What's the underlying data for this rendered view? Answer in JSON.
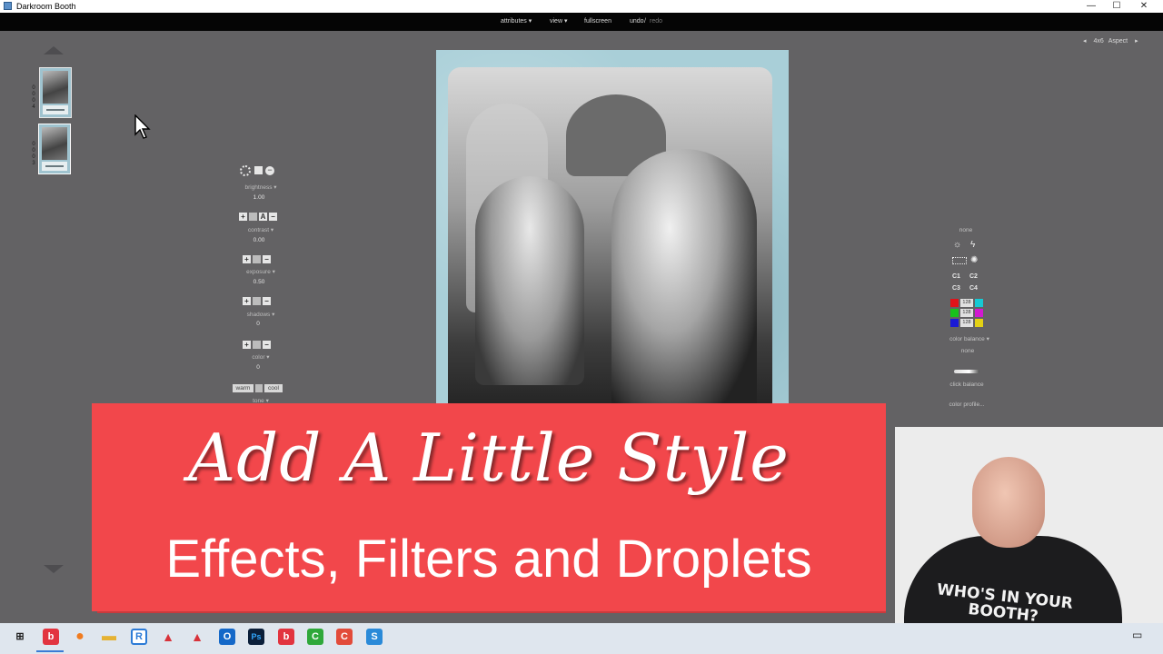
{
  "window": {
    "title": "Darkroom Booth",
    "controls": {
      "minimize": "—",
      "maximize": "☐",
      "close": "✕"
    }
  },
  "menu": {
    "attributes": "attributes ▾",
    "view": "view ▾",
    "fullscreen": "fullscreen",
    "undo": "undo",
    "sep": " / ",
    "redo": "redo"
  },
  "aspect": {
    "prev": "◂",
    "size": "4x6",
    "label": "Aspect",
    "next": "▸"
  },
  "thumbnails": [
    {
      "counter": [
        "0",
        "0",
        "0",
        "4"
      ]
    },
    {
      "counter": [
        "0",
        "0",
        "0",
        "3"
      ]
    }
  ],
  "adjustments": {
    "brightness": {
      "label": "brightness ▾",
      "value": "1.00"
    },
    "contrast": {
      "label": "contrast ▾",
      "value": "0.00",
      "auto": "A"
    },
    "exposure": {
      "label": "exposure ▾",
      "value": "0.50"
    },
    "shadows": {
      "label": "shadows ▾",
      "value": "0"
    },
    "color": {
      "label": "color ▾",
      "value": "0"
    },
    "tone": {
      "label": "tone ▾",
      "warm": "warm",
      "cool": "cool"
    }
  },
  "color_panel": {
    "preset": "none",
    "c_buttons": [
      "C1",
      "C2",
      "C3",
      "C4"
    ],
    "balance_values": [
      "128",
      "128",
      "128"
    ],
    "channel_colors": {
      "left": [
        "#e0121a",
        "#19c11c",
        "#1a1ad6"
      ],
      "right": [
        "#16c9d4",
        "#d11ad0",
        "#e3d114"
      ]
    },
    "balance_label": "color balance ▾",
    "balance_preset": "none",
    "click_balance": "click balance",
    "color_profile": "color profile..."
  },
  "banner": {
    "title": "Add A Little Style",
    "subtitle": "Effects, Filters and Droplets",
    "color": "#f2474b"
  },
  "presenter": {
    "shirt_text": "WHO'S IN YOUR BOOTH?"
  },
  "taskbar": {
    "icons": [
      {
        "name": "windows-start-icon",
        "glyph": "⊞",
        "color": "#1e1e1e"
      },
      {
        "name": "b-app-icon",
        "glyph": "b",
        "color": "#e2343f"
      },
      {
        "name": "firefox-icon",
        "glyph": "●",
        "color": "#f07b1f"
      },
      {
        "name": "file-explorer-icon",
        "glyph": "▬",
        "color": "#e5b233"
      },
      {
        "name": "r-app-icon",
        "glyph": "R",
        "color": "#2c7bd6"
      },
      {
        "name": "alert-app-icon-1",
        "glyph": "▲",
        "color": "#d8323a"
      },
      {
        "name": "alert-app-icon-2",
        "glyph": "▲",
        "color": "#d8323a"
      },
      {
        "name": "outlook-icon",
        "glyph": "O",
        "color": "#1468c8"
      },
      {
        "name": "photoshop-icon",
        "glyph": "Ps",
        "color": "#0b1f3a"
      },
      {
        "name": "b-app-icon-2",
        "glyph": "b",
        "color": "#e2343f"
      },
      {
        "name": "c-app-icon-green",
        "glyph": "C",
        "color": "#2fa83a"
      },
      {
        "name": "c-app-icon-red",
        "glyph": "C",
        "color": "#e24b3a"
      },
      {
        "name": "s-app-icon",
        "glyph": "S",
        "color": "#2a8ad8"
      }
    ],
    "notification": "▭"
  }
}
